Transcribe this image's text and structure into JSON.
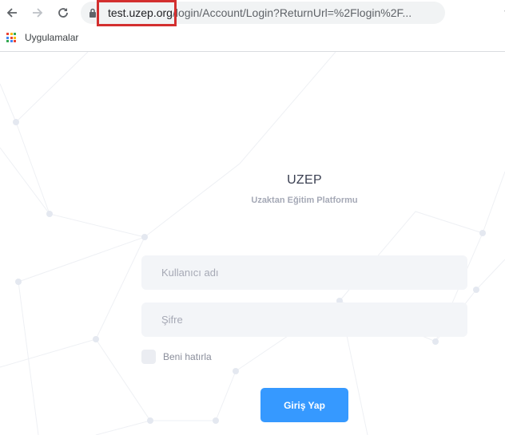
{
  "browser": {
    "url_host": "test.uzep.org",
    "url_path": "/login/Account/Login?ReturnUrl=%2Flogin%2F...",
    "bookmarks_bar": {
      "apps_label": "Uygulamalar"
    },
    "icons": [
      "back-icon",
      "forward-icon",
      "reload-icon",
      "lock-icon",
      "star-icon",
      "apps-icon"
    ]
  },
  "page": {
    "brand_title": "UZEP",
    "brand_subtitle": "Uzaktan Eğitim Platformu",
    "form": {
      "username_placeholder": "Kullanıcı adı",
      "password_placeholder": "Şifre",
      "remember_label": "Beni hatırla",
      "remember_checked": false,
      "submit_label": "Giriş Yap"
    }
  },
  "colors": {
    "accent": "#3699ff",
    "annotation_box": "#d32f2f",
    "field_bg": "#f3f5f8"
  }
}
